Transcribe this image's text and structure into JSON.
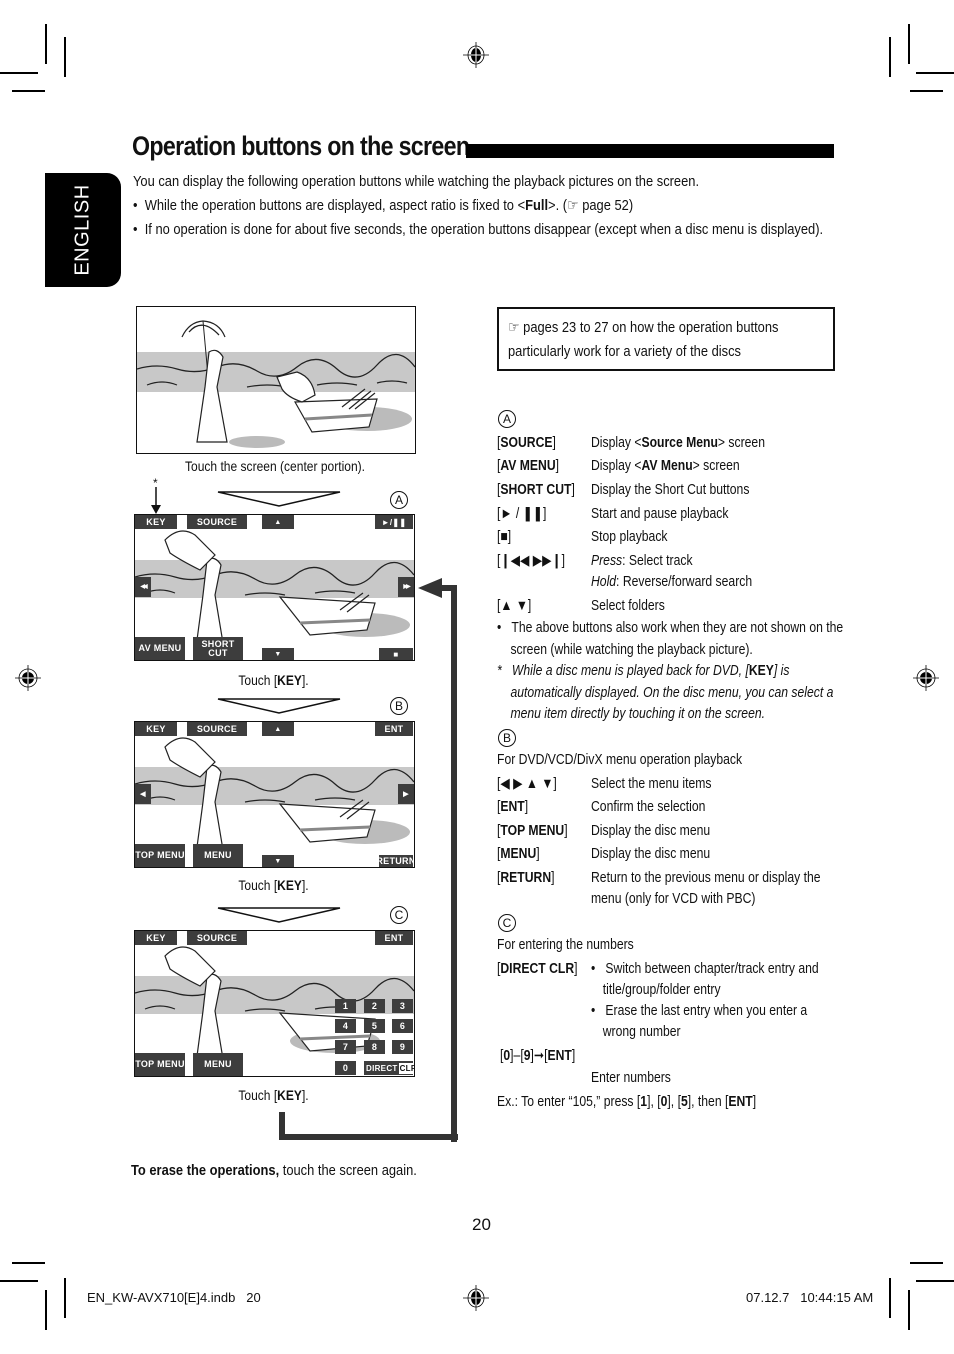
{
  "page": {
    "title": "Operation buttons on the screen",
    "language_tab": "ENGLISH",
    "page_number": "20",
    "footer_left": "EN_KW-AVX710[E]4.indb   20",
    "footer_right": "07.12.7   10:44:15 AM"
  },
  "intro": {
    "paragraph": "You can display the following operation buttons while watching the playback pictures on the screen.",
    "bullets": [
      {
        "pre": "While the operation buttons are displayed, aspect ratio is fixed to <",
        "bold": "Full",
        "post": ">. (☞ page 52)"
      },
      {
        "text": "If no operation is done for about five seconds, the operation buttons disappear (except when a disc menu is displayed)."
      }
    ]
  },
  "reference_box": "☞ pages 23 to 27 on how the operation buttons particularly work for a variety of the discs",
  "illustrations": {
    "step0_caption": "Touch the screen (center portion).",
    "asterisk": "*",
    "screens": [
      {
        "marker": "A",
        "caption_pre": "Touch [",
        "caption_bold": "KEY",
        "caption_post": "].",
        "buttons": {
          "key": "KEY",
          "source": "SOURCE",
          "up": "▲",
          "top_right": "►/❚❚",
          "left": "◀◀",
          "right": "▶▶",
          "bottom_left": "AV MENU",
          "bottom_mid": "SHORT CUT",
          "down": "▼",
          "bottom_right": "■"
        }
      },
      {
        "marker": "B",
        "caption_pre": "Touch [",
        "caption_bold": "KEY",
        "caption_post": "].",
        "buttons": {
          "key": "KEY",
          "source": "SOURCE",
          "up": "▲",
          "top_right": "ENT",
          "left": "◀",
          "right": "▶",
          "bottom_left": "TOP MENU",
          "bottom_mid": "MENU",
          "down": "▼",
          "bottom_right": "RETURN"
        }
      },
      {
        "marker": "C",
        "caption_pre": "Touch [",
        "caption_bold": "KEY",
        "caption_post": "].",
        "buttons": {
          "key": "KEY",
          "source": "SOURCE",
          "top_right": "ENT",
          "bottom_left": "TOP MENU",
          "bottom_mid": "MENU",
          "direct": "DIRECT",
          "clr": "CLR"
        },
        "keypad": [
          "1",
          "2",
          "3",
          "4",
          "5",
          "6",
          "7",
          "8",
          "9",
          "0"
        ]
      }
    ],
    "erase_bold": "To erase the operations,",
    "erase_text": " touch the screen again."
  },
  "section_a": {
    "marker": "A",
    "rows": [
      {
        "key": "SOURCE",
        "desc_pre": "Display <",
        "desc_bold": "Source Menu",
        "desc_post": "> screen"
      },
      {
        "key": "AV MENU",
        "desc_pre": "Display <",
        "desc_bold": "AV Menu",
        "desc_post": "> screen"
      },
      {
        "key": "SHORT CUT",
        "desc": "Display the Short Cut buttons"
      },
      {
        "key_plain": "► / ❚❚",
        "desc": "Start and pause playback"
      },
      {
        "key_plain": "■",
        "desc": "Stop playback"
      },
      {
        "key_plain": "❙◀◀ ▶▶❙",
        "desc_italic": "Press",
        "desc": ": Select track",
        "desc2_italic": "Hold",
        "desc2": ": Reverse/forward search"
      },
      {
        "key_plain": "▲ ▼",
        "desc": "Select folders"
      }
    ],
    "bullet": "The above buttons also work when they are not shown on the screen (while watching the playback picture).",
    "footnote_pre": "While a disc menu is played back for DVD, [",
    "footnote_bold": "KEY",
    "footnote_post": "] is automatically displayed. On the disc menu, you  can select a menu item directly by touching it on the screen."
  },
  "section_b": {
    "marker": "B",
    "heading": "For DVD/VCD/DivX menu operation playback",
    "rows": [
      {
        "key_plain": "◀ ▶ ▲ ▼",
        "desc": "Select the menu items"
      },
      {
        "key": "ENT",
        "desc": "Confirm the selection"
      },
      {
        "key": "TOP MENU",
        "desc": "Display the disc menu"
      },
      {
        "key": "MENU",
        "desc": "Display the disc menu"
      },
      {
        "key": "RETURN",
        "desc": "Return to the previous menu or display the",
        "desc2": "menu (only for VCD with PBC)"
      }
    ]
  },
  "section_c": {
    "marker": "C",
    "heading": "For entering the numbers",
    "direct_key": "DIRECT CLR",
    "direct_bullets": [
      {
        "l1": "Switch between chapter/track entry and",
        "l2": "title/group/folder entry"
      },
      {
        "l1": "Erase the last entry when you enter a",
        "l2": "wrong number"
      }
    ],
    "num_key_0": "0",
    "num_key_9": "9",
    "num_key_ent": "ENT",
    "num_desc": "Enter numbers",
    "example_pre": "Ex.: To enter “105,” press [",
    "example_k1": "1",
    "example_k2": "0",
    "example_k3": "5",
    "example_k4": "ENT"
  }
}
